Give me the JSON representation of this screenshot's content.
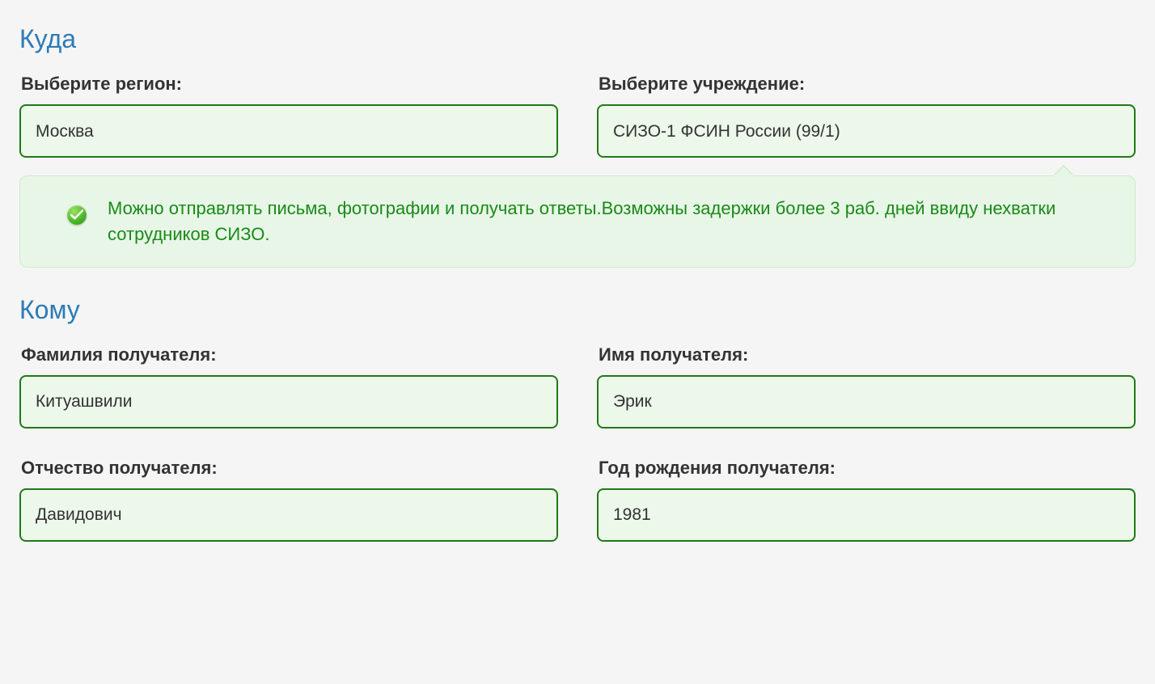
{
  "where": {
    "title": "Куда",
    "region_label": "Выберите регион:",
    "region_value": "Москва",
    "facility_label": "Выберите учреждение:",
    "facility_value": "СИЗО-1 ФСИН России (99/1)",
    "info": "Можно отправлять письма, фотографии и получать ответы.Возможны задержки более 3 раб. дней ввиду нехватки сотрудников СИЗО."
  },
  "whom": {
    "title": "Кому",
    "surname_label": "Фамилия получателя:",
    "surname_value": "Китуашвили",
    "firstname_label": "Имя получателя:",
    "firstname_value": "Эрик",
    "patronymic_label": "Отчество получателя:",
    "patronymic_value": "Давидович",
    "birthyear_label": "Год рождения получателя:",
    "birthyear_value": "1981"
  }
}
